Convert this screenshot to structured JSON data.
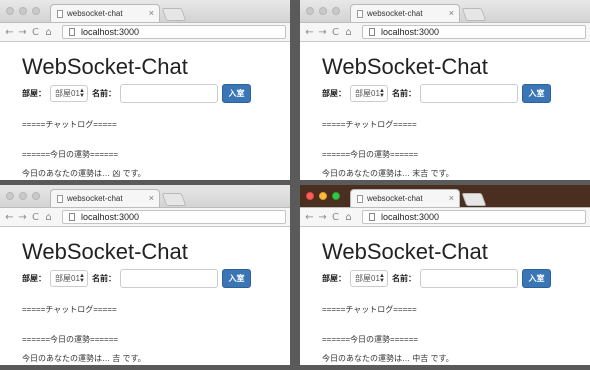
{
  "windows": [
    {
      "tab_title": "websocket-chat",
      "url": "localhost:3000",
      "heading": "WebSocket-Chat",
      "room_label": "部屋：",
      "room_value": "部屋01",
      "name_label": "名前：",
      "enter_label": "入室",
      "log_header": "=====チャットログ=====",
      "fortune_header": "======今日の運勢======",
      "fortune_text": "今日のあなたの運勢は… 凶 です。"
    },
    {
      "tab_title": "websocket-chat",
      "url": "localhost:3000",
      "heading": "WebSocket-Chat",
      "room_label": "部屋：",
      "room_value": "部屋01",
      "name_label": "名前：",
      "enter_label": "入室",
      "log_header": "=====チャットログ=====",
      "fortune_header": "======今日の運勢======",
      "fortune_text": "今日のあなたの運勢は… 末吉 です。"
    },
    {
      "tab_title": "websocket-chat",
      "url": "localhost:3000",
      "heading": "WebSocket-Chat",
      "room_label": "部屋：",
      "room_value": "部屋01",
      "name_label": "名前：",
      "enter_label": "入室",
      "log_header": "=====チャットログ=====",
      "fortune_header": "======今日の運勢======",
      "fortune_text": "今日のあなたの運勢は… 吉 です。"
    },
    {
      "tab_title": "websocket-chat",
      "url": "localhost:3000",
      "heading": "WebSocket-Chat",
      "room_label": "部屋：",
      "room_value": "部屋01",
      "name_label": "名前：",
      "enter_label": "入室",
      "log_header": "=====チャットログ=====",
      "fortune_header": "======今日の運勢======",
      "fortune_text": "今日のあなたの運勢は… 中吉 です。"
    }
  ],
  "icons": {
    "back": "←",
    "forward": "→",
    "reload": "C",
    "home": "⌂",
    "close": "×"
  },
  "colors": {
    "enter_button": "#3a76b6",
    "active_titlebar": "#4a2e1f"
  }
}
